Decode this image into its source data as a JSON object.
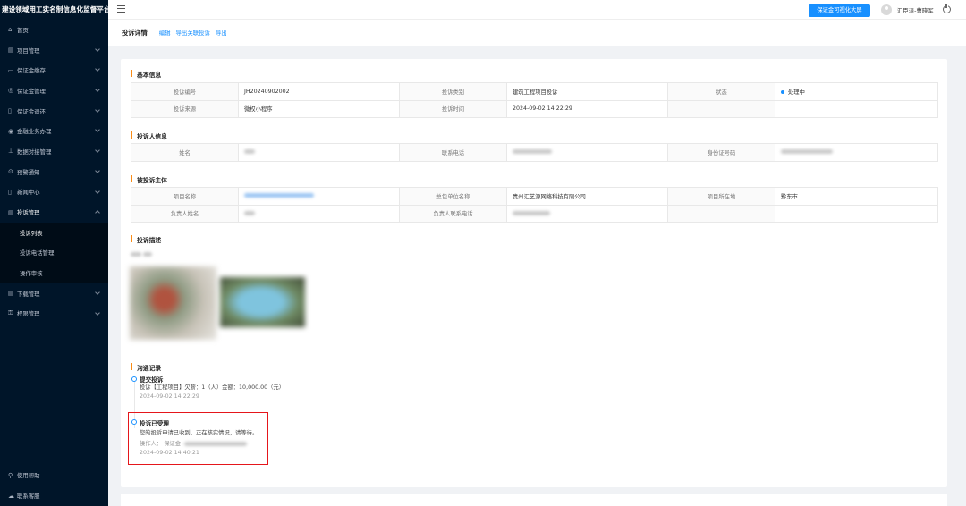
{
  "sidebar": {
    "title": "建设领域用工实名制信息化监督平台",
    "items": [
      {
        "label": "首页",
        "icon": "home-icon",
        "glyph": "⌂",
        "expandable": false
      },
      {
        "label": "项目管理",
        "icon": "project-icon",
        "glyph": "▤",
        "expandable": true
      },
      {
        "label": "保证金缴存",
        "icon": "deposit-icon",
        "glyph": "▭",
        "expandable": true
      },
      {
        "label": "保证金管理",
        "icon": "guarantee-icon",
        "glyph": "◎",
        "expandable": true
      },
      {
        "label": "保证金退还",
        "icon": "refund-icon",
        "glyph": "▯",
        "expandable": true
      },
      {
        "label": "金融业务办理",
        "icon": "finance-icon",
        "glyph": "◉",
        "expandable": true
      },
      {
        "label": "数据对接管理",
        "icon": "data-icon",
        "glyph": "⊥",
        "expandable": true
      },
      {
        "label": "预警通知",
        "icon": "warning-icon",
        "glyph": "⊙",
        "expandable": true
      },
      {
        "label": "新闻中心",
        "icon": "news-icon",
        "glyph": "▯",
        "expandable": true
      },
      {
        "label": "投诉管理",
        "icon": "complaint-icon",
        "glyph": "▤",
        "expandable": true,
        "open": true
      }
    ],
    "sub_items": [
      "投诉列表",
      "投诉电话管理",
      "操作审核"
    ],
    "items_after": [
      {
        "label": "下载管理",
        "icon": "download-icon",
        "glyph": "▤",
        "expandable": true
      },
      {
        "label": "权限管理",
        "icon": "permission-icon",
        "glyph": "⚿",
        "expandable": true
      }
    ],
    "bottom": [
      {
        "label": "使用帮助",
        "icon": "help-icon",
        "glyph": "⚲"
      },
      {
        "label": "联系客服",
        "icon": "service-icon",
        "glyph": "☁"
      }
    ]
  },
  "topbar": {
    "big_screen_btn": "保证金可视化大屏",
    "user": "汇臣派-曹晓军"
  },
  "page": {
    "title": "投诉详情",
    "links": [
      "编辑",
      "导出关联投诉",
      "导出"
    ]
  },
  "basic": {
    "title": "基本信息",
    "no_label": "投诉编号",
    "no": "JH20240902002",
    "type_label": "投诉类别",
    "type": "建筑工程项目投诉",
    "status_label": "状态",
    "status": "处理中",
    "source_label": "投诉来源",
    "source": "微权小程序",
    "time_label": "投诉时间",
    "time": "2024-09-02 14:22:29"
  },
  "complainant": {
    "title": "投诉人信息",
    "name_label": "姓名",
    "phone_label": "联系电话",
    "id_label": "身份证号码"
  },
  "subject": {
    "title": "被投诉主体",
    "project_label": "项目名称",
    "contractor_label": "总包单位名称",
    "contractor": "贵州汇艺源网络科技有限公司",
    "location_label": "项目所在地",
    "location": "黔东市",
    "manager_label": "负责人姓名",
    "manager_phone_label": "负责人联系电话"
  },
  "description": {
    "title": "投诉描述"
  },
  "records": {
    "title": "沟通记录",
    "entries": [
      {
        "title": "提交投诉",
        "desc": "投诉【工程项目】欠薪：1（人）金额：10,000.00（元）",
        "time": "2024-09-02 14:22:29"
      },
      {
        "title": "投诉已受理",
        "desc": "您的投诉申请已收到，正在核实情况，请等待。",
        "operator_label": "操作人：",
        "operator": "保证金",
        "time": "2024-09-02 14:40:21"
      }
    ]
  },
  "colors": {
    "accent": "#1890ff",
    "sidebar": "#001529",
    "section_bar": "#fa8c16",
    "highlight": "#e5161b"
  }
}
